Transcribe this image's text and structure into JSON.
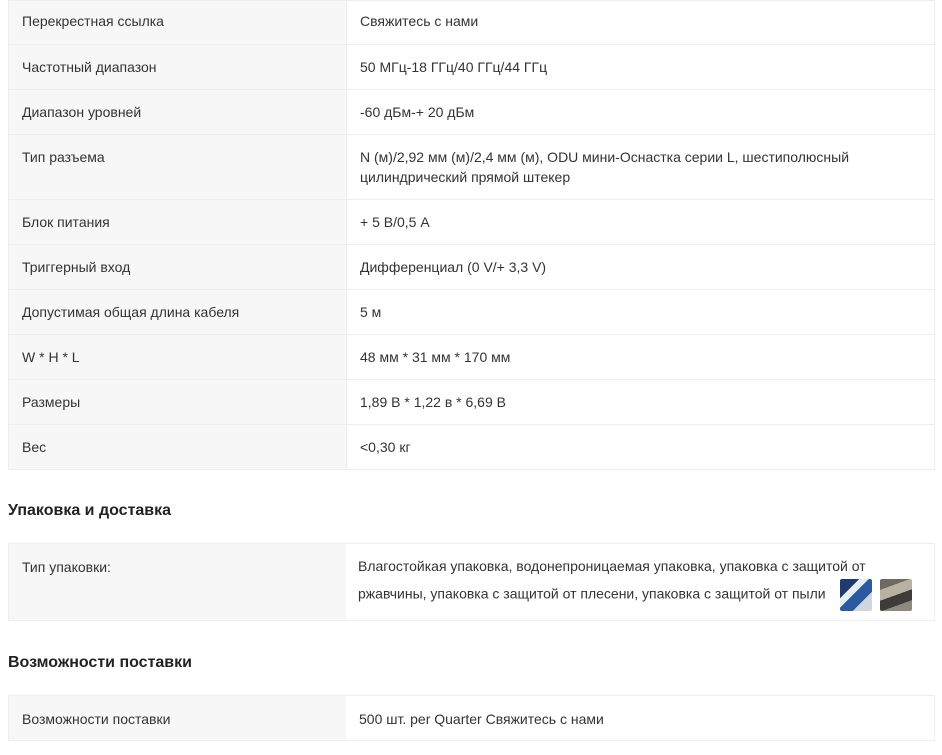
{
  "specs": [
    {
      "key": "Перекрестная ссылка",
      "value": "Свяжитесь с нами"
    },
    {
      "key": "Частотный диапазон",
      "value": "50 МГц-18 ГГц/40 ГГц/44 ГГц"
    },
    {
      "key": "Диапазон уровней",
      "value": "-60 дБм-+ 20 дБм"
    },
    {
      "key": "Тип разъема",
      "value": "N (м)/2,92 мм (м)/2,4 мм (м), ODU мини-Оснастка серии L, шестиполюсный цилиндрический прямой штекер"
    },
    {
      "key": "Блок питания",
      "value": "+ 5 В/0,5 А"
    },
    {
      "key": "Триггерный вход",
      "value": "Дифференциал (0 V/+ 3,3 V)"
    },
    {
      "key": "Допустимая общая длина кабеля",
      "value": "5 м"
    },
    {
      "key": "W * H * L",
      "value": "48 мм * 31 мм * 170 мм"
    },
    {
      "key": "Размеры",
      "value": "1,89 В * 1,22 в * 6,69 В"
    },
    {
      "key": "Вес",
      "value": "<0,30 кг"
    }
  ],
  "packaging": {
    "title": "Упаковка и доставка",
    "key": "Тип упаковки:",
    "value": "Влагостойкая упаковка, водонепроницаемая упаковка, упаковка с защитой от ржавчины, упаковка с защитой от плесени, упаковка с защитой от пыли",
    "thumbnails": [
      "packaging-photo-icon",
      "warehouse-photo-icon"
    ]
  },
  "supply": {
    "title": "Возможности поставки",
    "key": "Возможности поставки",
    "value": "500 шт. per Quarter Свяжитесь с нами"
  }
}
